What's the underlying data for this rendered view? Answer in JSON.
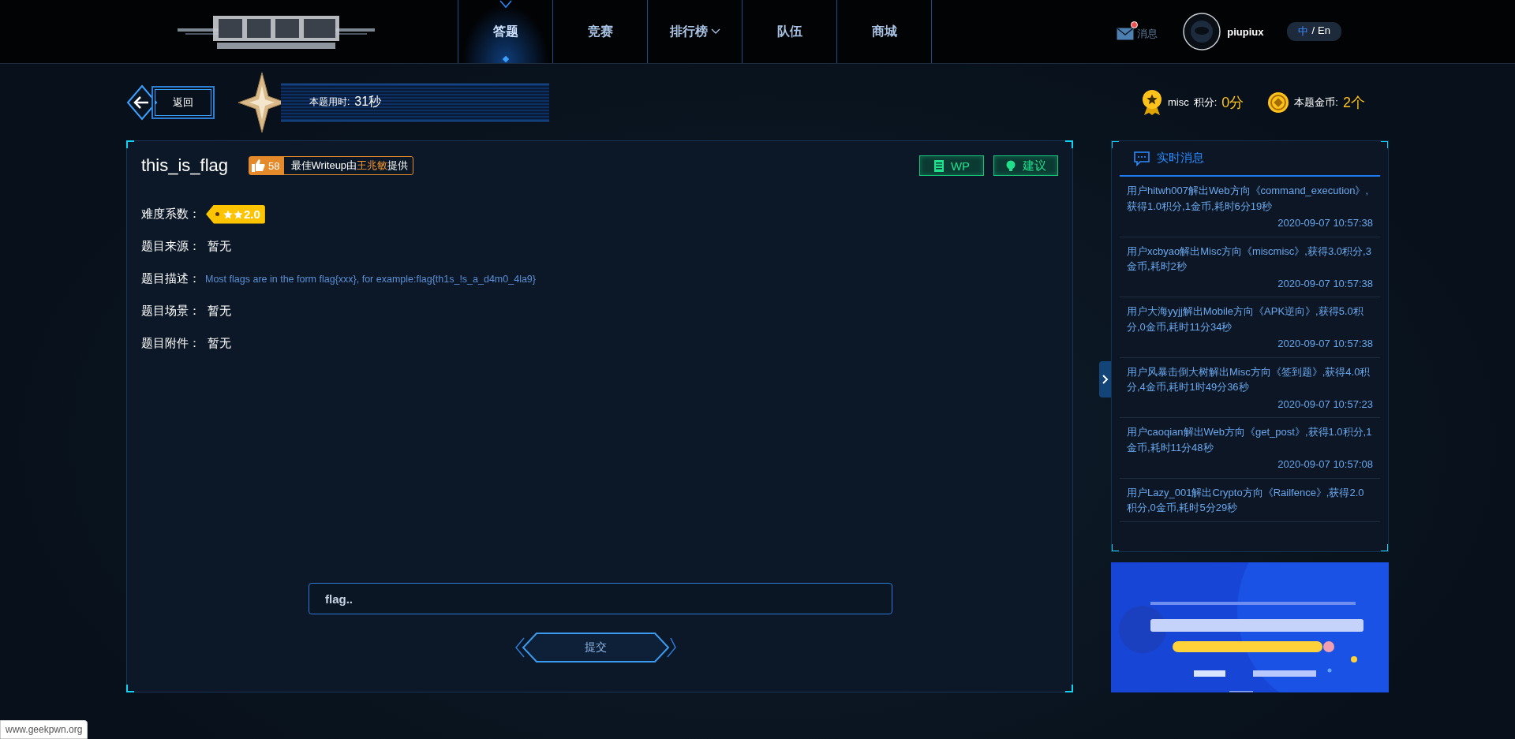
{
  "header": {
    "nav": [
      {
        "label": "答题",
        "selected": true,
        "dropdown": false
      },
      {
        "label": "竞赛",
        "selected": false,
        "dropdown": false
      },
      {
        "label": "排行榜",
        "selected": false,
        "dropdown": true
      },
      {
        "label": "队伍",
        "selected": false,
        "dropdown": false
      },
      {
        "label": "商城",
        "selected": false,
        "dropdown": false
      }
    ],
    "messages_label": "消息",
    "unread": true,
    "username": "piupiux",
    "language": {
      "separator": "/",
      "options": [
        {
          "label": "中",
          "selected": true
        },
        {
          "label": "En",
          "selected": false
        }
      ]
    }
  },
  "toolbar": {
    "back_label": "返回",
    "timer_label": "本题用时:",
    "timer_value": "31秒",
    "category": "misc",
    "score_label": "积分:",
    "score_value": "0分",
    "coins_label": "本题金币:",
    "coins_value": "2个"
  },
  "challenge": {
    "title": "this_is_flag",
    "likes": "58",
    "writeup_prefix": "最佳Writeup由",
    "writeup_author": "王兆敏",
    "writeup_suffix": "提供",
    "buttons": [
      {
        "label": "WP",
        "kind": "wp"
      },
      {
        "label": "建议",
        "kind": "suggest"
      }
    ],
    "fields": [
      {
        "label": "难度系数：",
        "kind": "difficulty",
        "stars": 2,
        "value": "2.0"
      },
      {
        "label": "题目来源：",
        "kind": "text",
        "value": "暂无"
      },
      {
        "label": "题目描述：",
        "kind": "description",
        "value": "Most flags are in the form flag{xxx}, for example:flag{th1s_!s_a_d4m0_4la9}"
      },
      {
        "label": "题目场景：",
        "kind": "text",
        "value": "暂无"
      },
      {
        "label": "题目附件：",
        "kind": "text",
        "value": "暂无"
      }
    ],
    "flag_input": {
      "placeholder": "flag.."
    },
    "submit_label": "提交"
  },
  "feed": {
    "title": "实时消息",
    "items": [
      {
        "text": "用户hitwh007解出Web方向《command_execution》,获得1.0积分,1金币,耗时6分19秒",
        "time": "2020-09-07 10:57:38"
      },
      {
        "text": "用户xcbyao解出Misc方向《miscmisc》,获得3.0积分,3金币,耗时2秒",
        "time": "2020-09-07 10:57:38"
      },
      {
        "text": "用户大海yyjj解出Mobile方向《APK逆向》,获得5.0积分,0金币,耗时11分34秒",
        "time": "2020-09-07 10:57:38"
      },
      {
        "text": "用户风暴击倒大树解出Misc方向《签到题》,获得4.0积分,4金币,耗时1时49分36秒",
        "time": "2020-09-07 10:57:23"
      },
      {
        "text": "用户caoqian解出Web方向《get_post》,获得1.0积分,1金币,耗时11分48秒",
        "time": "2020-09-07 10:57:08"
      },
      {
        "text": "用户Lazy_001解出Crypto方向《Railfence》,获得2.0积分,0金币,耗时5分29秒"
      }
    ]
  },
  "status_url": "www.geekpwn.org"
}
